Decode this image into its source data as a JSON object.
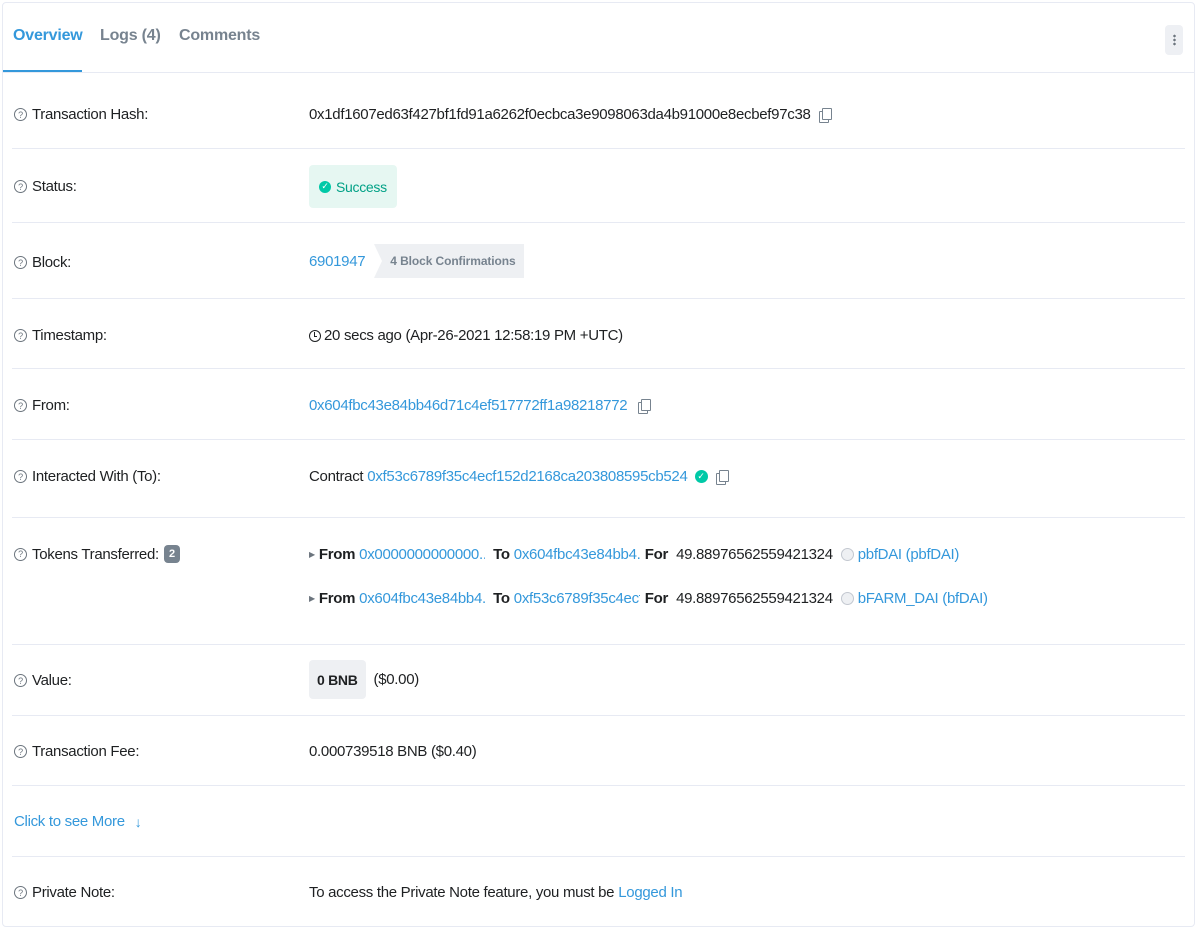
{
  "tabs": [
    {
      "label": "Overview",
      "active": true
    },
    {
      "label": "Logs (4)",
      "active": false
    },
    {
      "label": "Comments",
      "active": false
    }
  ],
  "rows": {
    "tx_hash": {
      "label": "Transaction Hash:",
      "value": "0x1df1607ed63f427bf1fd91a6262f0ecbca3e9098063da4b91000e8ecbef97c38"
    },
    "status": {
      "label": "Status:",
      "value": "Success"
    },
    "block": {
      "label": "Block:",
      "value": "6901947",
      "confirmations": "4 Block Confirmations"
    },
    "timestamp": {
      "label": "Timestamp:",
      "value": "20 secs ago (Apr-26-2021 12:58:19 PM +UTC)"
    },
    "from": {
      "label": "From:",
      "value": "0x604fbc43e84bb46d71c4ef517772ff1a98218772"
    },
    "interacted": {
      "label": "Interacted With (To):",
      "prefix": "Contract",
      "value": "0xf53c6789f35c4ecf152d2168ca203808595cb524"
    },
    "tokens": {
      "label": "Tokens Transferred:",
      "count": "2",
      "from_kw": "From",
      "to_kw": "To",
      "for_kw": "For",
      "items": [
        {
          "from": "0x0000000000000...",
          "to": "0x604fbc43e84bb4...",
          "amount": "49.88976562559421324",
          "token": "pbfDAI (pbfDAI)"
        },
        {
          "from": "0x604fbc43e84bb4...",
          "to": "0xf53c6789f35c4ecf...",
          "amount": "49.88976562559421324",
          "token": "bFARM_DAI (bfDAI)"
        }
      ]
    },
    "value": {
      "label": "Value:",
      "amount": "0 BNB",
      "usd": "($0.00)"
    },
    "fee": {
      "label": "Transaction Fee:",
      "value": "0.000739518 BNB ($0.40)"
    },
    "more": {
      "label": "Click to see More"
    },
    "note": {
      "label": "Private Note:",
      "text": "To access the Private Note feature, you must be",
      "link": "Logged In"
    }
  },
  "colors": {
    "accent": "#3498db",
    "success": "#00c9a7",
    "text": "#1e2022",
    "muted": "#77838f"
  }
}
